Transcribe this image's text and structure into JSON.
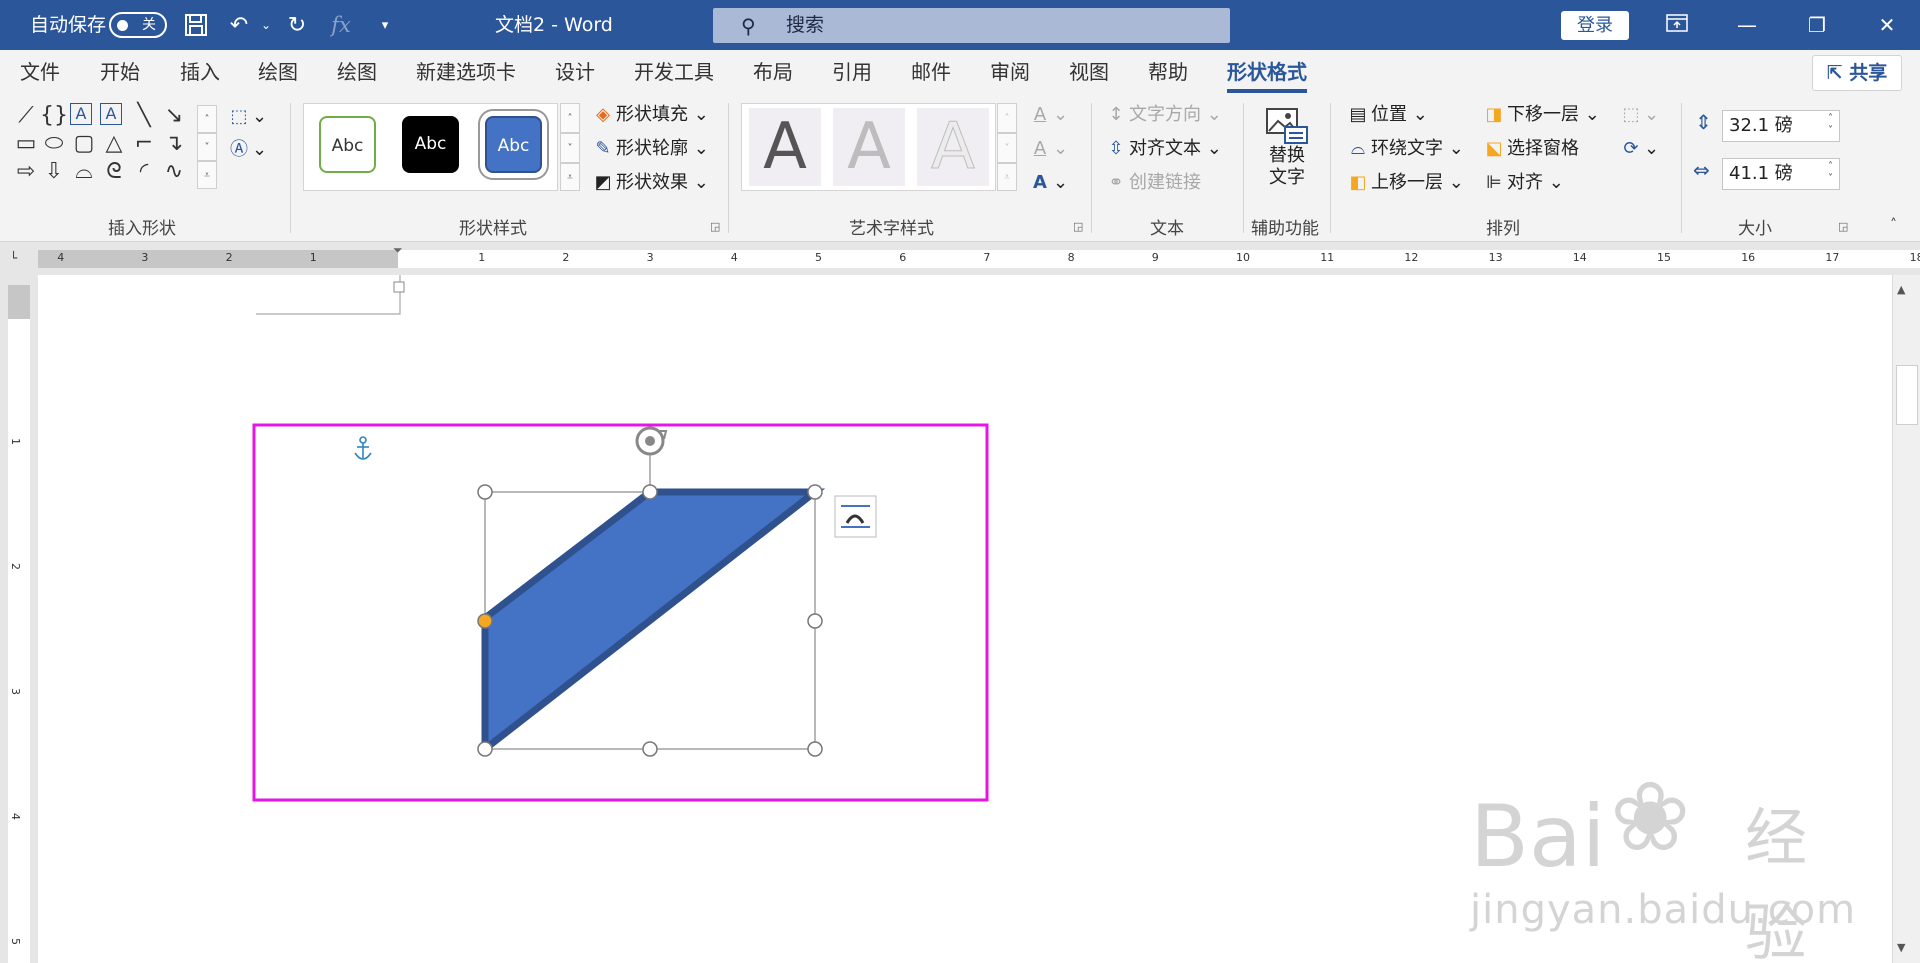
{
  "titlebar": {
    "autosave_label": "自动保存",
    "autosave_state": "关",
    "doc_title": "文档2  -  Word",
    "search_placeholder": "搜索",
    "login_label": "登录",
    "fx_label": "fx"
  },
  "tabs": [
    {
      "label": "文件"
    },
    {
      "label": "开始"
    },
    {
      "label": "插入"
    },
    {
      "label": "绘图"
    },
    {
      "label": "绘图"
    },
    {
      "label": "新建选项卡"
    },
    {
      "label": "设计"
    },
    {
      "label": "开发工具"
    },
    {
      "label": "布局"
    },
    {
      "label": "引用"
    },
    {
      "label": "邮件"
    },
    {
      "label": "审阅"
    },
    {
      "label": "视图"
    },
    {
      "label": "帮助"
    },
    {
      "label": "形状格式"
    }
  ],
  "share_label": "共享",
  "ribbon": {
    "groups": {
      "insert_shapes": "插入形状",
      "shape_styles": "形状样式",
      "wordart_styles": "艺术字样式",
      "text": "文本",
      "accessibility": "辅助功能",
      "arrange": "排列",
      "size": "大小"
    },
    "style_abc": [
      "Abc",
      "Abc",
      "Abc"
    ],
    "wordart_letter": "A",
    "shape_fill": "形状填充",
    "shape_outline": "形状轮廓",
    "shape_effects": "形状效果",
    "text_direction": "文字方向",
    "align_text": "对齐文本",
    "create_link": "创建链接",
    "alt_text_line1": "替换",
    "alt_text_line2": "文字",
    "position": "位置",
    "wrap_text": "环绕文字",
    "bring_forward": "上移一层",
    "send_backward": "下移一层",
    "selection_pane": "选择窗格",
    "align": "对齐",
    "height": "32.1 磅",
    "width": "41.1 磅"
  },
  "ruler_h": [
    "4",
    "3",
    "2",
    "1",
    "1",
    "2",
    "3",
    "4",
    "5",
    "6",
    "7",
    "8",
    "9",
    "10",
    "11",
    "12",
    "13",
    "14",
    "15",
    "16",
    "17",
    "18"
  ],
  "ruler_v": [
    "1",
    "2",
    "3",
    "4",
    "5"
  ],
  "watermark": {
    "line1": "Bai",
    "line1b": "经验",
    "line2": "jingyan.baidu.com"
  },
  "colors": {
    "titlebar": "#2b579a",
    "shape_fill": "#4472c4",
    "shape_outline": "#2f528f",
    "highlight_box": "#e614e6",
    "adjust_handle": "#f5a623"
  }
}
